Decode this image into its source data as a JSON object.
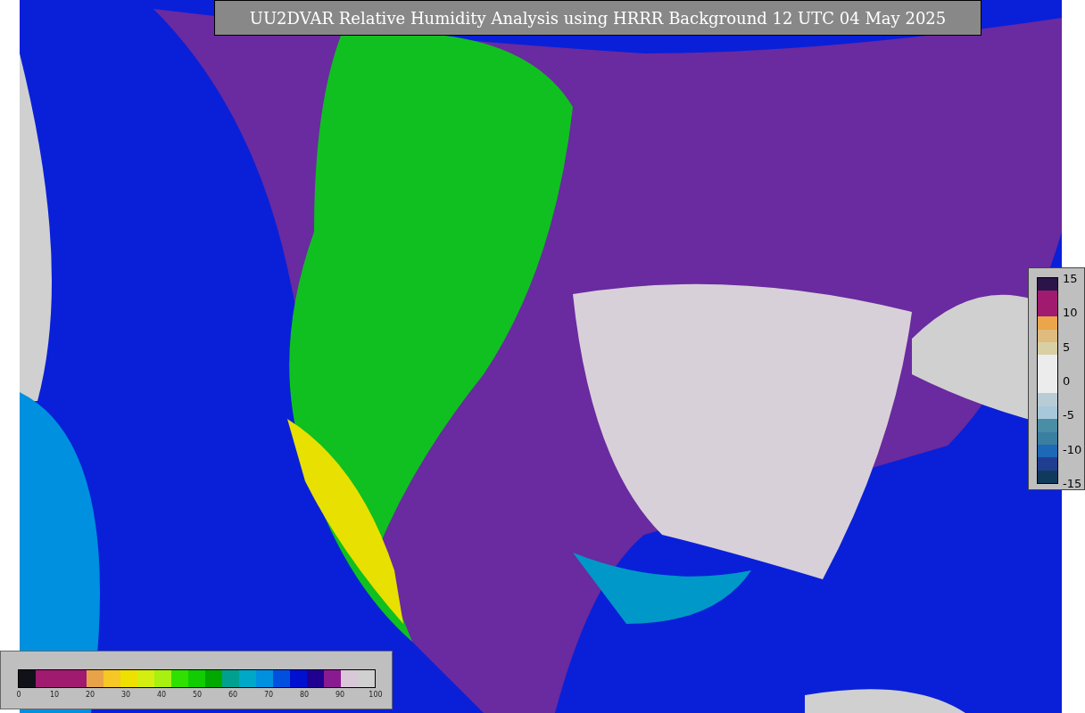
{
  "title": "UU2DVAR Relative Humidity Analysis using HRRR Background 12 UTC 04 May 2025",
  "humidity_colorbar": {
    "ticks": [
      "0",
      "10",
      "20",
      "30",
      "40",
      "50",
      "60",
      "70",
      "80",
      "90",
      "100"
    ]
  },
  "difference_colorbar": {
    "ticks": [
      "15",
      "10",
      "5",
      "0",
      "-5",
      "-10",
      "-15"
    ]
  }
}
